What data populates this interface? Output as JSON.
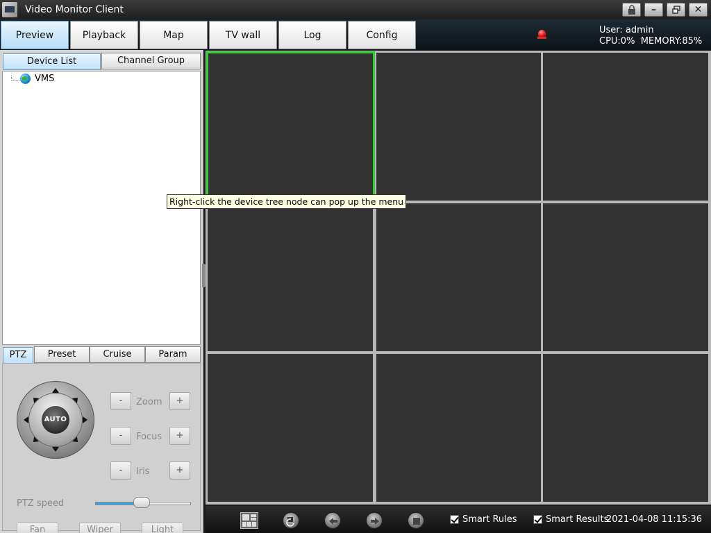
{
  "window": {
    "title": "Video Monitor Client",
    "controls": [
      "lock-icon",
      "minimize-icon",
      "restore-icon",
      "close-icon"
    ]
  },
  "nav": {
    "tabs": [
      {
        "label": "Preview",
        "active": true
      },
      {
        "label": "Playback",
        "active": false
      },
      {
        "label": "Map",
        "active": false
      },
      {
        "label": "TV wall",
        "active": false
      },
      {
        "label": "Log",
        "active": false
      },
      {
        "label": "Config",
        "active": false
      }
    ],
    "user": "User: admin",
    "stats": "CPU:0%  MEMORY:85%"
  },
  "sidebar": {
    "tabs": [
      {
        "label": "Device List",
        "active": true
      },
      {
        "label": "Channel Group",
        "active": false
      }
    ],
    "tree": [
      {
        "label": "VMS",
        "icon": "globe-icon"
      }
    ],
    "tooltip": "Right-click the device tree node can pop up the menu"
  },
  "ptz": {
    "tabs": [
      {
        "label": "PTZ",
        "active": true
      },
      {
        "label": "Preset",
        "active": false
      },
      {
        "label": "Cruise",
        "active": false
      },
      {
        "label": "Param",
        "active": false
      }
    ],
    "auto_label": "AUTO",
    "controls": [
      {
        "label": "Zoom",
        "minus": "-",
        "plus": "+"
      },
      {
        "label": "Focus",
        "minus": "-",
        "plus": "+"
      },
      {
        "label": "Iris",
        "minus": "-",
        "plus": "+"
      }
    ],
    "speed_label": "PTZ speed",
    "speed_value": 0.5,
    "buttons": [
      "Fan",
      "Wiper",
      "Light"
    ]
  },
  "video": {
    "layout": "3x3",
    "selected_cell": 0,
    "accent": "#33cc33"
  },
  "toolbar": {
    "icons": [
      "layout-icon",
      "sequence-icon",
      "previous-page-icon",
      "next-page-icon",
      "stop-all-icon"
    ],
    "smart_rules": {
      "label": "Smart Rules",
      "checked": true
    },
    "smart_results": {
      "label": "Smart Results",
      "checked": true
    },
    "datetime": "2021-04-08 11:15:36"
  }
}
